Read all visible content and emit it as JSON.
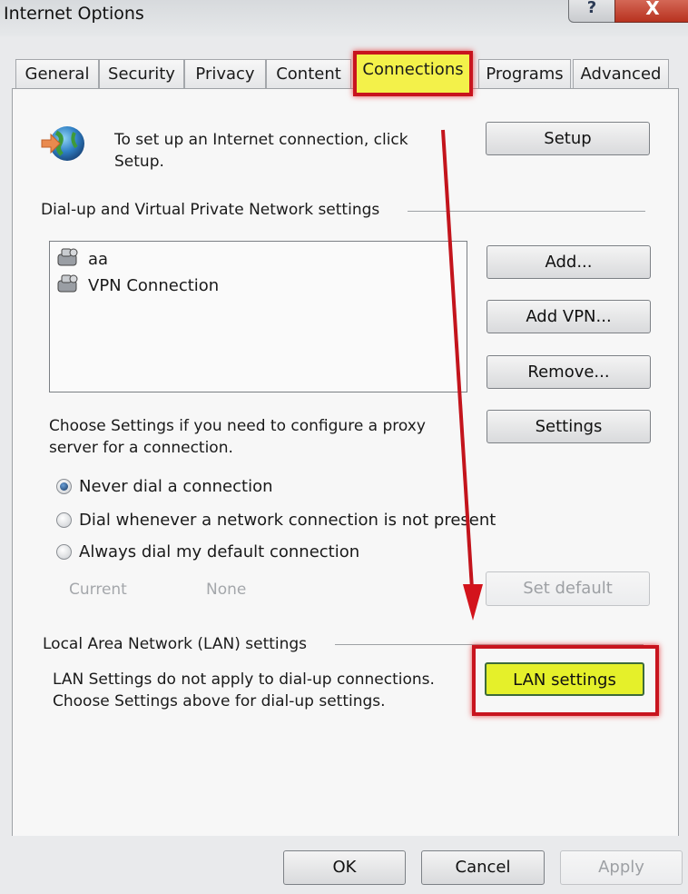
{
  "window": {
    "title": "Internet Options",
    "help_label": "?",
    "close_label": "X"
  },
  "tabs": [
    {
      "label": "General",
      "active": false
    },
    {
      "label": "Security",
      "active": false
    },
    {
      "label": "Privacy",
      "active": false
    },
    {
      "label": "Content",
      "active": false
    },
    {
      "label": "Connections",
      "active": true
    },
    {
      "label": "Programs",
      "active": false
    },
    {
      "label": "Advanced",
      "active": false
    }
  ],
  "setup": {
    "icon": "globe-connection-icon",
    "text_line1": "To set up an Internet connection, click",
    "text_line2": "Setup.",
    "button": "Setup"
  },
  "dialup": {
    "group_label": "Dial-up and Virtual Private Network settings",
    "connections": [
      {
        "icon": "network-connection-icon",
        "label": "aa"
      },
      {
        "icon": "network-connection-icon",
        "label": "VPN Connection"
      }
    ],
    "add_button": "Add...",
    "add_vpn_button": "Add VPN...",
    "remove_button": "Remove...",
    "settings_text_line1": "Choose Settings if you need to configure a proxy",
    "settings_text_line2": "server for a connection.",
    "settings_button": "Settings",
    "radio_options": [
      {
        "label": "Never dial a connection",
        "checked": true
      },
      {
        "label": "Dial whenever a network connection is not present",
        "checked": false
      },
      {
        "label": "Always dial my default connection",
        "checked": false
      }
    ],
    "current_label": "Current",
    "current_value": "None",
    "set_default_button": "Set default"
  },
  "lan": {
    "group_label": "Local Area Network (LAN) settings",
    "text_line1": "LAN Settings do not apply to dial-up connections.",
    "text_line2": "Choose Settings above for dial-up settings.",
    "button": "LAN settings"
  },
  "footer": {
    "ok": "OK",
    "cancel": "Cancel",
    "apply": "Apply"
  },
  "annotations": {
    "highlight_color": "#c8141e",
    "marker_color": "#f3f14a"
  }
}
